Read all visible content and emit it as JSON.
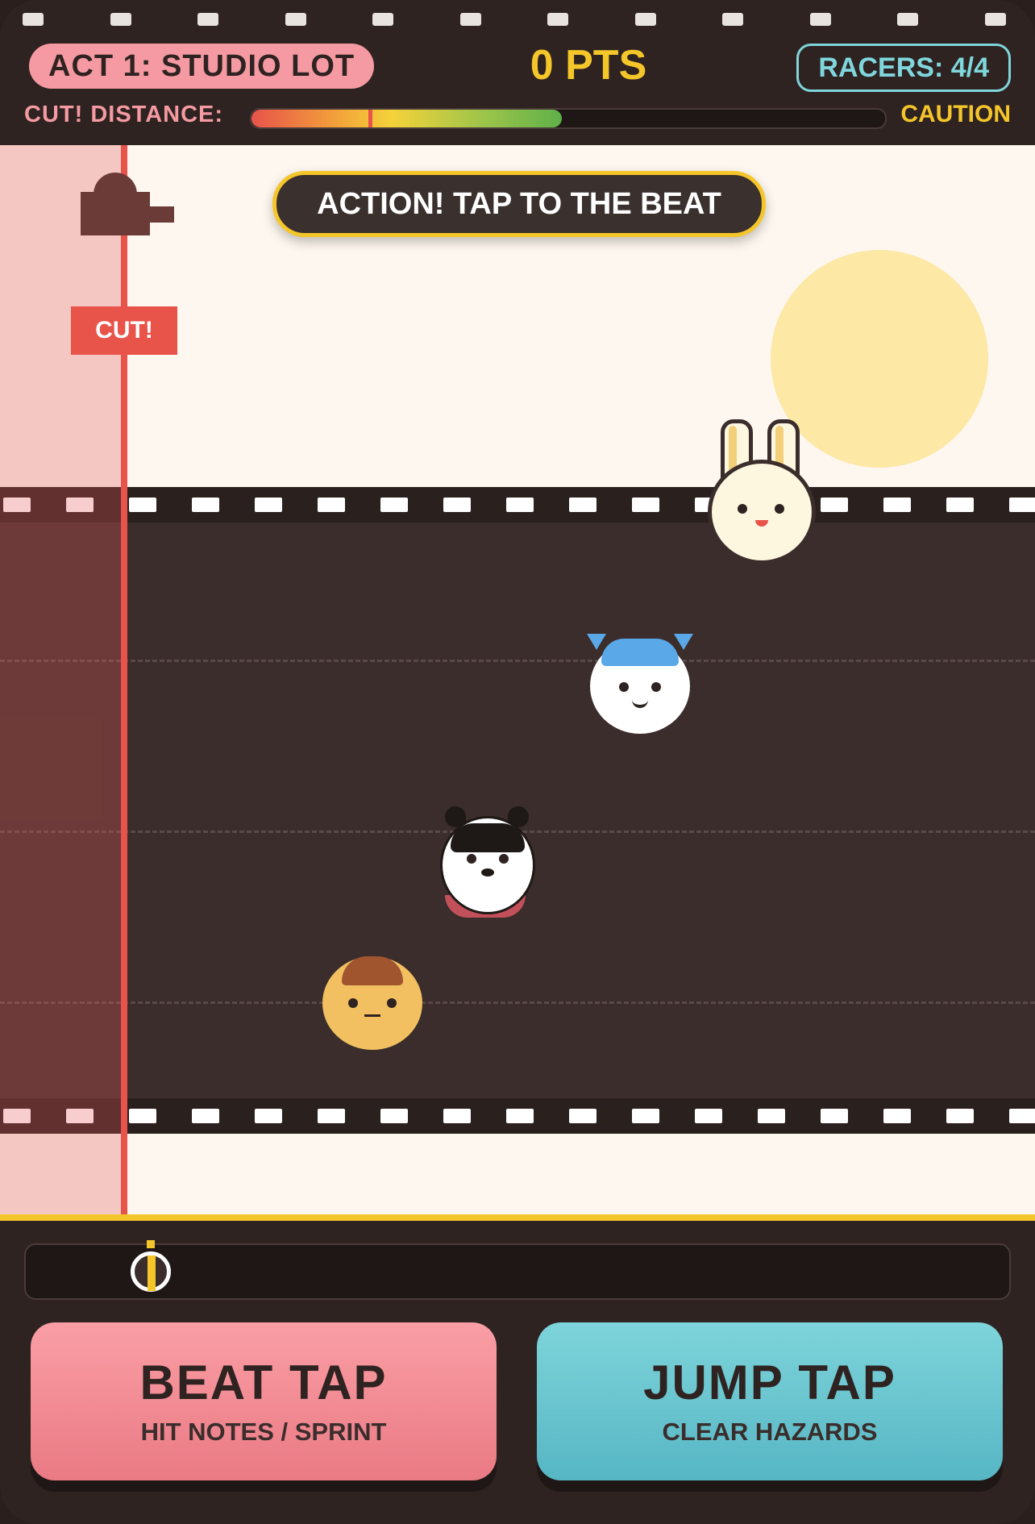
{
  "hud": {
    "act_label": "ACT 1: STUDIO LOT",
    "points_label": "0 PTS",
    "racers_label": "RACERS: 4/4",
    "cut_distance_label": "CUT! DISTANCE:",
    "cut_distance_fraction": 0.49,
    "cut_marker_fraction": 0.185,
    "status_label": "CAUTION"
  },
  "stage": {
    "banner": "ACTION! TAP TO THE BEAT",
    "cut_sign": "CUT!",
    "racers": [
      {
        "name": "bunny-racer",
        "lane": 0
      },
      {
        "name": "blue-hat-racer",
        "lane": 1
      },
      {
        "name": "husky-racer",
        "lane": 2
      },
      {
        "name": "orange-hair-racer",
        "lane": 3
      }
    ]
  },
  "controls": {
    "beat_tap_label": "BEAT TAP",
    "beat_tap_sub": "HIT NOTES / SPRINT",
    "jump_tap_label": "JUMP TAP",
    "jump_tap_sub": "CLEAR HAZARDS"
  },
  "colors": {
    "accent_yellow": "#f5c62a",
    "pink": "#f59aa2",
    "teal": "#7fd6dc",
    "danger_red": "#e8534a",
    "track": "#3a2d2b"
  }
}
